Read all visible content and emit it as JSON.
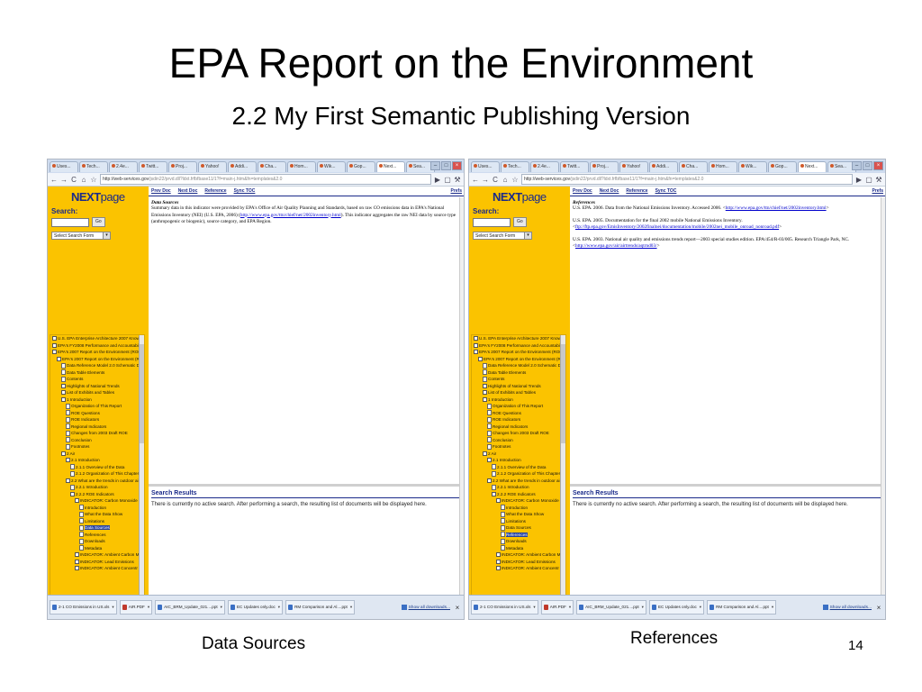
{
  "slide": {
    "title": "EPA Report on the Environment",
    "subtitle": "2.2 My First Semantic Publishing Version",
    "page_number": "14"
  },
  "captions": {
    "left": "Data Sources",
    "right": "References"
  },
  "browser": {
    "tabs": [
      "Uses...",
      "Tech...",
      "2.4e...",
      "Twitt...",
      "Proj...",
      "Yahoo!",
      "Addi...",
      "Cha...",
      "Hom...",
      "Wik...",
      "Gop...",
      "Next...",
      "Sea..."
    ],
    "active_tab_index": 11,
    "url_host": "http://web-services.gov",
    "url_path": "/jsdin22/prvd.dll?ldxt.frfbfbase11/1?f=main-j.htm&fn=templates&2.0",
    "window_controls": [
      "–",
      "□",
      "×"
    ]
  },
  "nextpage": {
    "logo_next": "NEXT",
    "logo_page": "page",
    "search_label": "Search:",
    "go_label": "Go",
    "select_value": "Select Search Form",
    "nav_links": [
      "Prev Doc",
      "Next Doc",
      "Reference",
      "Sync TOC"
    ],
    "prefs_label": "Prefs",
    "tree": [
      {
        "text": "U.S. EPA Enterprise Architecture 2007 Knowle",
        "indent": 0,
        "kind": "box"
      },
      {
        "text": "EPA's FY2008 Performance and Accountabilit",
        "indent": 0,
        "kind": "box"
      },
      {
        "text": "EPA's 2007 Report on the Environment (ROE)",
        "indent": 0,
        "kind": "box"
      },
      {
        "text": "EPA's 2007 Report on the Environment (R(",
        "indent": 1,
        "kind": "box"
      },
      {
        "text": "Data Reference Model 2.0 Schematic Di",
        "indent": 2,
        "kind": "doc"
      },
      {
        "text": "Data Table Elements",
        "indent": 2,
        "kind": "doc"
      },
      {
        "text": "Contents",
        "indent": 2,
        "kind": "doc"
      },
      {
        "text": "Highlights of National Trends",
        "indent": 2,
        "kind": "box"
      },
      {
        "text": "List of Exhibits and Tables",
        "indent": 2,
        "kind": "box"
      },
      {
        "text": "1 Introduction",
        "indent": 2,
        "kind": "box"
      },
      {
        "text": "Organization of This Report",
        "indent": 3,
        "kind": "doc"
      },
      {
        "text": "ROE Questions",
        "indent": 3,
        "kind": "doc"
      },
      {
        "text": "ROE Indicators",
        "indent": 3,
        "kind": "doc"
      },
      {
        "text": "Regional Indicators",
        "indent": 3,
        "kind": "doc"
      },
      {
        "text": "Changes from 2003 Draft ROE",
        "indent": 3,
        "kind": "doc"
      },
      {
        "text": "Conclusion",
        "indent": 3,
        "kind": "doc"
      },
      {
        "text": "Footnotes",
        "indent": 3,
        "kind": "doc"
      },
      {
        "text": "2 Air",
        "indent": 2,
        "kind": "box"
      },
      {
        "text": "2.1 Introduction",
        "indent": 3,
        "kind": "box"
      },
      {
        "text": "2.1.1 Overview of the Data",
        "indent": 4,
        "kind": "doc"
      },
      {
        "text": "2.1.2 Organization of This Chapter",
        "indent": 4,
        "kind": "doc"
      },
      {
        "text": "2.2 What are the trends in outdoor air",
        "indent": 3,
        "kind": "box"
      },
      {
        "text": "2.2.1 Introduction",
        "indent": 4,
        "kind": "doc"
      },
      {
        "text": "2.2.2 ROE Indicators",
        "indent": 4,
        "kind": "box"
      },
      {
        "text": "INDICATOR: Carbon Monoxide E",
        "indent": 5,
        "kind": "box"
      },
      {
        "text": "Introduction",
        "indent": 6,
        "kind": "doc"
      },
      {
        "text": "What the Data Show",
        "indent": 6,
        "kind": "doc"
      },
      {
        "text": "Limitations",
        "indent": 6,
        "kind": "doc"
      },
      {
        "text": "Data Sources",
        "indent": 6,
        "kind": "doc"
      },
      {
        "text": "References",
        "indent": 6,
        "kind": "doc"
      },
      {
        "text": "Downloads",
        "indent": 6,
        "kind": "doc"
      },
      {
        "text": "Metadata",
        "indent": 6,
        "kind": "doc"
      },
      {
        "text": "INDICATOR: Ambient Carbon M",
        "indent": 5,
        "kind": "box"
      },
      {
        "text": "INDICATOR: Lead Emissions",
        "indent": 5,
        "kind": "box"
      },
      {
        "text": "INDICATOR: Ambient Concentr",
        "indent": 5,
        "kind": "box"
      }
    ],
    "results_title": "Search Results",
    "results_text": "There is currently no active search. After performing a search, the resulting list of documents will be displayed here."
  },
  "left_doc": {
    "heading": "Data Sources",
    "para_before_link": "Summary data in this indicator were provided by EPA's Office of Air Quality Planning and Standards, based on raw CO emissions data in EPA's National Emissions Inventory (NEI) (U.S. EPA, 2006) (",
    "link": "http://www.epa.gov/ttn/chief/net/2002inventory.html",
    "para_after_link": "). This indicator aggregates the raw NEI data by source type (anthropogenic or biogenic), source category, and EPA Region.",
    "selected_tree_index": 28
  },
  "right_doc": {
    "heading": "References",
    "refs": [
      {
        "text": "U.S. EPA. 2006. Data from the National Emissions Inventory. Accessed 2006.",
        "link": "http://www.epa.gov/ttn/chief/net/2002inventory.html"
      },
      {
        "text": "U.S. EPA. 2005. Documentation for the final 2002 mobile National Emissions Inventory.",
        "link": "ftp://ftp.epa.gov/EmisInventory/2002finalnei/documentation/mobile/2002nei_mobile_onroad_nonroad.pdf"
      },
      {
        "text": "U.S. EPA. 2003. National air quality and emissions trends report—2003 special studies edition. EPA/454/R-03/005. Research Triangle Park, NC.",
        "link": "http://www.epa.gov/air/airtrends/aqtrnd03/"
      }
    ],
    "selected_tree_index": 29
  },
  "downloads": {
    "items": [
      {
        "name": "2-1 CO Emissions in US.xls",
        "type": "doc"
      },
      {
        "name": "AIR.PDF",
        "type": "pdf"
      },
      {
        "name": "AIC_BRM_Update_021....ppt",
        "type": "doc"
      },
      {
        "name": "EC Updates only.doc",
        "type": "doc"
      },
      {
        "name": "RM Comparison and Al....ppt",
        "type": "doc"
      }
    ],
    "show_all": "Show all downloads...",
    "close": "×"
  },
  "colors": {
    "panel_yellow": "#fbc300",
    "nav_blue": "#1a2a8a",
    "link_blue": "#0000cc"
  }
}
